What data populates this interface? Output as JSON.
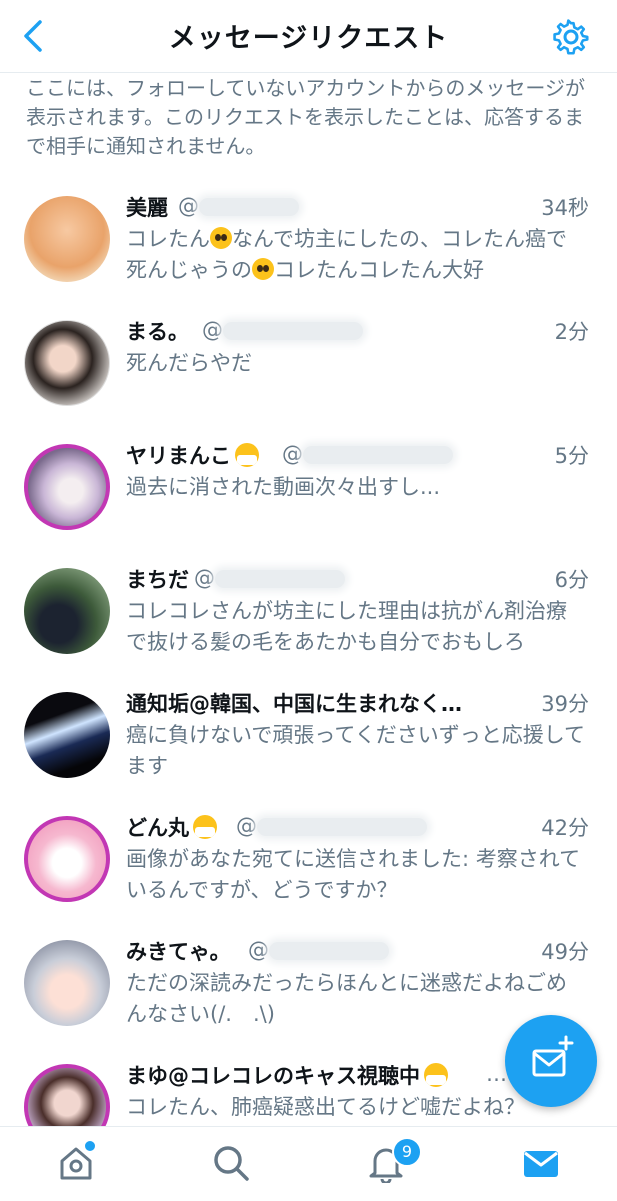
{
  "header": {
    "title": "メッセージリクエスト"
  },
  "notice": "ここには、フォローしていないアカウントからのメッセージが表示されます。このリクエストを表示したことは、応答するまで相手に通知されません。",
  "requests": [
    {
      "name": "美麗",
      "handle": "@",
      "time": "34秒",
      "msg_parts": [
        "コレたん",
        "なんで坊主にしたの、コレたん癌で死んじゃうの",
        "コレたんコレたん大好"
      ]
    },
    {
      "name": "まる。",
      "handle": "@",
      "time": "2分",
      "msg": "死んだらやだ"
    },
    {
      "name": "ヤリまんこ",
      "handle": "@",
      "time": "5分",
      "msg": "過去に消された動画次々出すし..."
    },
    {
      "name": "まちだ",
      "handle": "@",
      "time": "6分",
      "msg": "コレコレさんが坊主にした理由は抗がん剤治療で抜ける髪の毛をあたかも自分でおもしろ"
    },
    {
      "name": "通知垢@韓国、中国に生まれなく…",
      "handle": "",
      "time": "39分",
      "msg": "癌に負けないで頑張ってくださいずっと応援してます"
    },
    {
      "name": "どん丸",
      "handle": "@",
      "time": "42分",
      "msg": "画像があなた宛てに送信されました: 考察されているんですが、どうですか？"
    },
    {
      "name": "みきてゃ。",
      "handle": "@",
      "time": "49分",
      "msg": "ただの深読みだったらほんとに迷惑だよねごめんなさい(/.　.\\)"
    },
    {
      "name": "まゆ@コレコレのキャス視聴中",
      "handle": "…",
      "time": "",
      "msg": "コレたん、肺癌疑惑出てるけど嘘だよね？"
    }
  ],
  "tabbar": {
    "notifications_badge": "9"
  },
  "colors": {
    "accent": "#1da1f2",
    "text": "#0f1419",
    "secondary": "#657786",
    "divider": "#e6ecf0"
  },
  "icons": [
    "back-chevron-icon",
    "gear-icon",
    "home-icon",
    "search-icon",
    "bell-icon",
    "mail-icon",
    "new-message-icon"
  ]
}
